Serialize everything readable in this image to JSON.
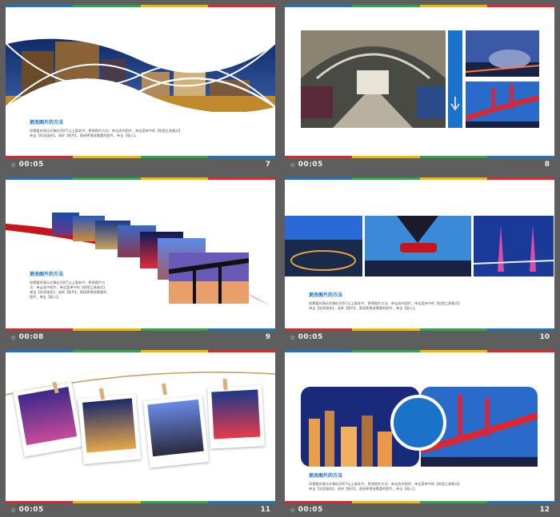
{
  "slides": [
    {
      "time": "00:05",
      "number": "7",
      "title": "更改图片的方法",
      "line1": "如需要的演示文稿在2007以上版本中，更改图片方法：单击选中图片，单击菜单中的【绘图工具格式】",
      "line2": "单击【形状填充】，选择【图片】，直接更换成需要的图片，单击【插入】。"
    },
    {
      "time": "00:05",
      "number": "8"
    },
    {
      "time": "00:08",
      "number": "9",
      "title": "更改图片的方法",
      "line1": "如需要的演示文稿在2007以上版本中，更改图片方法：单击选中图片，单击菜单中的【绘图工具格式】",
      "line2": "单击【形状填充】，选择【图片】，直接更换成需要的图片，单击【插入】。"
    },
    {
      "time": "00:05",
      "number": "10",
      "title": "更改图片的方法",
      "line1": "如需要的演示文稿在2007以上版本中，更改图片方法：单击选中图片，单击菜单中的【绘图工具格式】",
      "line2": "单击【形状填充】，选择【图片】，直接更换成需要的图片，单击【插入】。"
    },
    {
      "time": "00:05",
      "number": "11"
    },
    {
      "time": "00:05",
      "number": "12",
      "title": "更改图片的方法",
      "line1": "如需要的演示文稿在2007以上版本中，更改图片方法：单击选中图片，单击菜单中的【绘图工具格式】",
      "line2": "单击【形状填充】，选择【图片】，直接更换成需要的图片，单击【插入】。"
    }
  ],
  "colors": {
    "blue": "#1a73c8",
    "green": "#2ba84a",
    "yellow": "#f2b705",
    "red": "#e0262d",
    "background": "#5e5e5e"
  },
  "icons": {
    "timer": "star-icon"
  }
}
